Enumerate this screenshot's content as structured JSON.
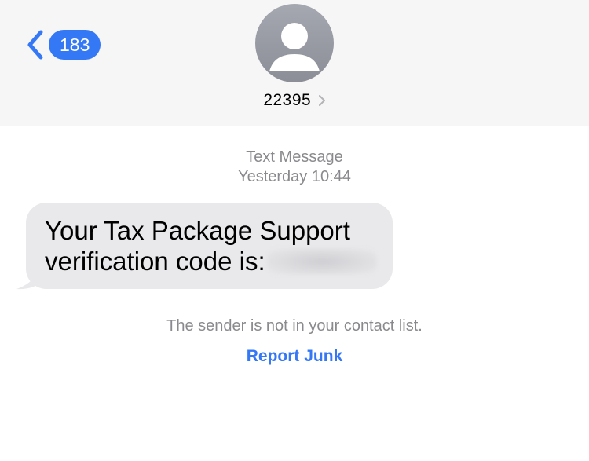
{
  "header": {
    "back_count": "183",
    "contact_name": "22395",
    "avatar_icon": "person-silhouette-icon",
    "back_icon": "chevron-left-icon",
    "name_chevron_icon": "chevron-right-icon"
  },
  "conversation": {
    "service_label": "Text Message",
    "timestamp": "Yesterday 10:44",
    "messages": [
      {
        "direction": "incoming",
        "text_line1": "Your Tax Package Support",
        "text_line2": "verification code is:",
        "code_redacted": true
      }
    ]
  },
  "notice": {
    "text": "The sender is not in your contact list.",
    "action_label": "Report Junk"
  },
  "colors": {
    "accent": "#3478f6",
    "bubble_incoming": "#e9e9eb",
    "secondary_text": "#8a8a8e",
    "header_bg": "#f6f6f6"
  }
}
